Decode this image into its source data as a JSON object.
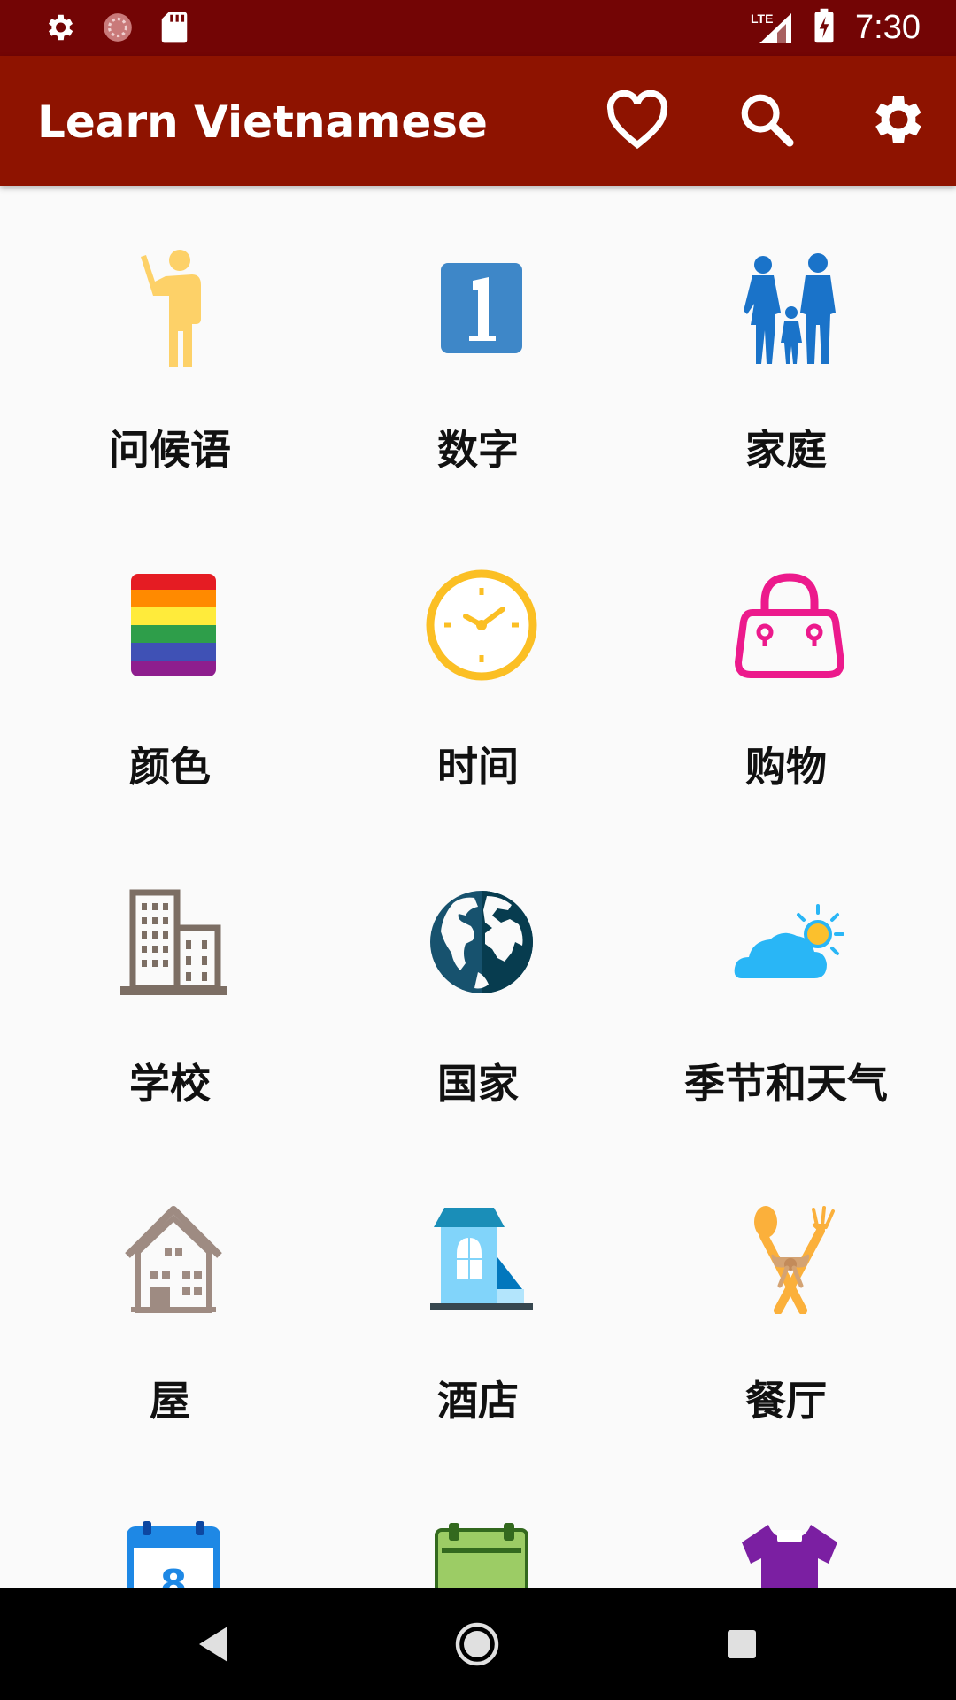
{
  "status_bar": {
    "time": "7:30",
    "network": "LTE"
  },
  "app_bar": {
    "title": "Learn Vietnamese",
    "actions": [
      {
        "icon": "heart-icon"
      },
      {
        "icon": "search-icon"
      },
      {
        "icon": "gear-icon"
      }
    ]
  },
  "categories": [
    {
      "label": "问候语",
      "icon": "waving-person-icon"
    },
    {
      "label": "数字",
      "icon": "number-one-icon"
    },
    {
      "label": "家庭",
      "icon": "family-icon"
    },
    {
      "label": "颜色",
      "icon": "color-stripes-icon"
    },
    {
      "label": "时间",
      "icon": "clock-icon"
    },
    {
      "label": "购物",
      "icon": "handbag-icon"
    },
    {
      "label": "学校",
      "icon": "buildings-icon"
    },
    {
      "label": "国家",
      "icon": "globe-icon"
    },
    {
      "label": "季节和天气",
      "icon": "weather-icon"
    },
    {
      "label": "屋",
      "icon": "house-icon"
    },
    {
      "label": "酒店",
      "icon": "hotel-icon"
    },
    {
      "label": "餐厅",
      "icon": "cutlery-icon"
    },
    {
      "label": "",
      "icon": "calendar-icon"
    },
    {
      "label": "",
      "icon": "board-icon"
    },
    {
      "label": "",
      "icon": "shirt-icon"
    }
  ],
  "colors": {
    "status_bar": "#730505",
    "app_bar": "#8e1300",
    "background": "#fafafa"
  }
}
